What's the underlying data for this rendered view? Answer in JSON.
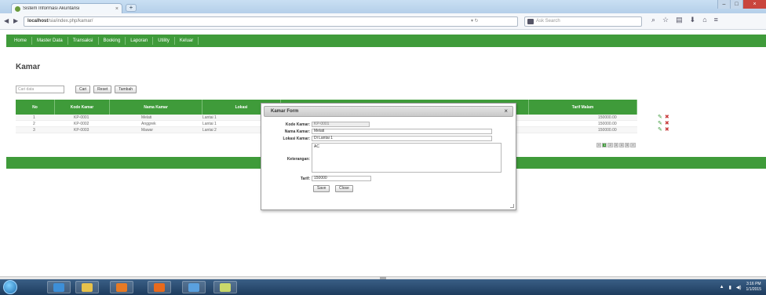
{
  "browser": {
    "tab_title": "Sistem Informasi Akuntansi",
    "tab_close": "×",
    "new_tab": "+",
    "url_host": "localhost",
    "url_path": "/sia/index.php/kamar/",
    "search_placeholder": "Ask Search",
    "window_buttons": [
      "–",
      "□",
      "×"
    ]
  },
  "menu": {
    "items": [
      "Home",
      "Master Data",
      "Transaksi",
      "Booking",
      "Laporan",
      "Utility",
      "Keluar"
    ]
  },
  "page": {
    "title": "Kamar",
    "search_placeholder": "Cari data",
    "search_buttons": [
      "Cari",
      "Reset",
      "Tambah"
    ]
  },
  "table": {
    "headers": [
      "No",
      "Kode Kamar",
      "Nama Kamar",
      "Lokasi",
      "Tarif Malam"
    ],
    "rows": [
      {
        "no": "1",
        "kode": "KP-0001",
        "nama": "Melati",
        "lokasi": "Lantai 1",
        "tarif": "150000.00"
      },
      {
        "no": "2",
        "kode": "KP-0002",
        "nama": "Anggrek",
        "lokasi": "Lantai 1",
        "tarif": "150000.00"
      },
      {
        "no": "3",
        "kode": "KP-0003",
        "nama": "Mawar",
        "lokasi": "Lantai 2",
        "tarif": "150000.00"
      }
    ],
    "pager": [
      "«",
      "1",
      "2",
      "3",
      "4",
      "5",
      "»"
    ]
  },
  "dialog": {
    "title": "Kamar Form",
    "close": "×",
    "labels": {
      "kode": "Kode Kamar:",
      "nama": "Nama Kamar:",
      "lokasi": "Lokasi Kamar:",
      "keterangan": "Keterangan:",
      "tarif": "Tarif:"
    },
    "values": {
      "kode": "KP-0001",
      "nama": "Melati",
      "lokasi": "Di Lantai 1",
      "keterangan": "AC",
      "tarif": "150000"
    },
    "buttons": {
      "save": "Save",
      "close": "Close"
    }
  },
  "taskbar": {
    "time": "3:16 PM",
    "date": "1/1/2015"
  },
  "colors": {
    "brand_green": "#3f9b3a",
    "edit_icon": "#3c9a3b",
    "delete_icon": "#c83b3b"
  }
}
